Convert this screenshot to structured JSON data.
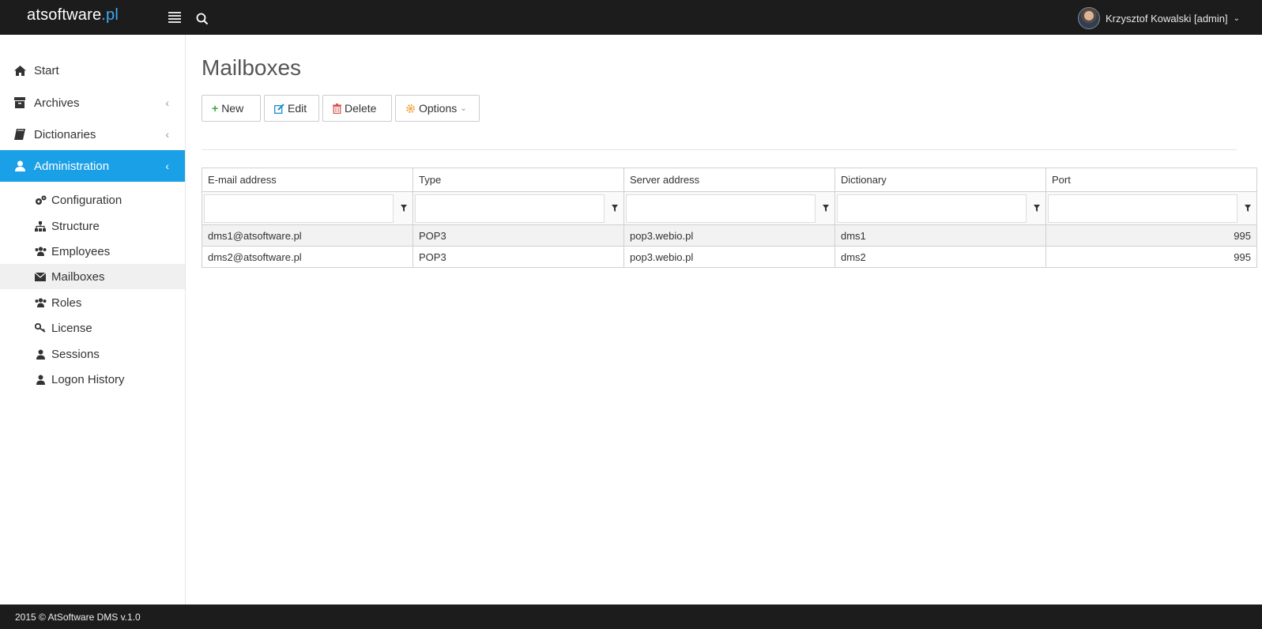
{
  "brand": {
    "name": "atsoftware",
    "tld": ".pl"
  },
  "header": {
    "user": "Krzysztof Kowalski [admin]"
  },
  "sidebar": {
    "items": [
      {
        "label": "Start"
      },
      {
        "label": "Archives"
      },
      {
        "label": "Dictionaries"
      },
      {
        "label": "Administration"
      }
    ],
    "admin_items": [
      {
        "label": "Configuration"
      },
      {
        "label": "Structure"
      },
      {
        "label": "Employees"
      },
      {
        "label": "Mailboxes"
      },
      {
        "label": "Roles"
      },
      {
        "label": "License"
      },
      {
        "label": "Sessions"
      },
      {
        "label": "Logon History"
      }
    ]
  },
  "main": {
    "title": "Mailboxes",
    "toolbar": {
      "new": "New",
      "edit": "Edit",
      "delete": "Delete",
      "options": "Options"
    },
    "table": {
      "columns": [
        "E-mail address",
        "Type",
        "Server address",
        "Dictionary",
        "Port"
      ],
      "rows": [
        [
          "dms1@atsoftware.pl",
          "POP3",
          "pop3.webio.pl",
          "dms1",
          "995"
        ],
        [
          "dms2@atsoftware.pl",
          "POP3",
          "pop3.webio.pl",
          "dms2",
          "995"
        ]
      ]
    }
  },
  "footer": {
    "text": "2015 © AtSoftware DMS v.1.0"
  },
  "colors": {
    "accent": "#1aa0e6",
    "topbar": "#1c1c1c",
    "new_icon": "#3aa53a",
    "delete_icon": "#d9534f",
    "options_icon": "#f0ad4e"
  }
}
